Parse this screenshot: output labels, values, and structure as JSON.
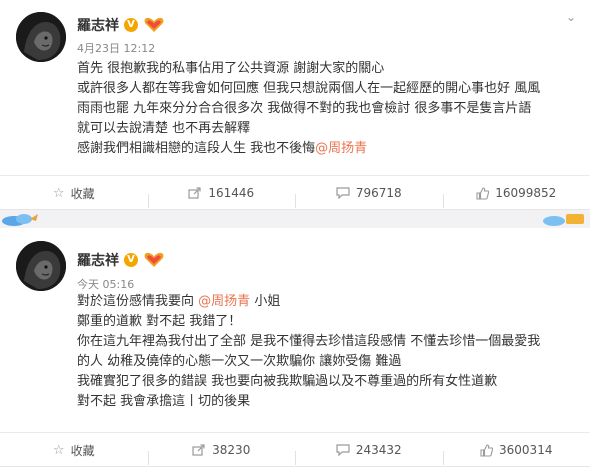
{
  "post1": {
    "author": "羅志祥",
    "date": "4月23日 12:12",
    "lines": [
      "首先 很抱歉我的私事佔用了公共資源 謝謝大家的關心",
      "或許很多人都在等我會如何回應 但我只想說兩個人在一起經歷的開心事也好 風風",
      "雨雨也罷 九年來分分合合很多次 我做得不對的我也會檢討 很多事不是隻言片語",
      "就可以去說清楚 也不再去解釋"
    ],
    "last_line_text": "感謝我們相識相戀的這段人生 我也不後悔",
    "mention": "@周扬青",
    "favorite_label": "收藏",
    "share_count": "161446",
    "comment_count": "796718",
    "like_count": "16099852"
  },
  "post2": {
    "author": "羅志祥",
    "date": "今天 05:16",
    "line1_prefix": "對於這份感情我要向",
    "mention": "@周扬青",
    "line1_suffix": "小姐",
    "lines": [
      "鄭重的道歉 對不起 我錯了！",
      "你在這九年裡為我付出了全部 是我不懂得去珍惜這段感情 不懂去珍惜一個最愛我",
      "的人 幼稚及僥倖的心態一次又一次欺騙你 讓妳受傷 難過",
      "我確實犯了很多的錯誤 我也要向被我欺騙過以及不尊重過的所有女性道歉",
      "對不起   我會承擔這丨切的後果"
    ],
    "favorite_label": "收藏",
    "share_count": "38230",
    "comment_count": "243432",
    "like_count": "3600314"
  },
  "colors": {
    "mention": "#eb7350",
    "verified_badge": "#f5a500",
    "page_bg": "#f2f2f5"
  },
  "icons": [
    "lion-avatar",
    "verified-v-icon",
    "member-heart-icon",
    "chevron-down-icon",
    "star-icon",
    "share-icon",
    "comment-icon",
    "like-icon"
  ]
}
